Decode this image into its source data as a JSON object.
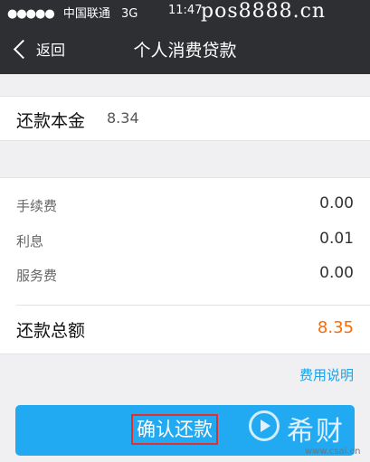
{
  "status_bar": {
    "signal_dots": "●●●●●",
    "carrier": "中国联通",
    "network": "3G",
    "time": "11:47",
    "watermark": "pos8888.cn"
  },
  "nav": {
    "back_label": "返回",
    "title": "个人消费贷款"
  },
  "principal": {
    "label": "还款本金",
    "value": "8.34"
  },
  "fees": [
    {
      "label": "手续费",
      "value": "0.00"
    },
    {
      "label": "利息",
      "value": "0.01"
    },
    {
      "label": "服务费",
      "value": "0.00"
    }
  ],
  "total": {
    "label": "还款总额",
    "value": "8.35"
  },
  "fee_link": "费用说明",
  "confirm_button": "确认还款",
  "watermark2": {
    "name": "希财",
    "url": "www.csai.cn"
  },
  "colors": {
    "nav_background": "#2d2f33",
    "accent_blue": "#21a9f1",
    "total_orange": "#ff6a00",
    "link_blue": "#1aa3e8"
  }
}
